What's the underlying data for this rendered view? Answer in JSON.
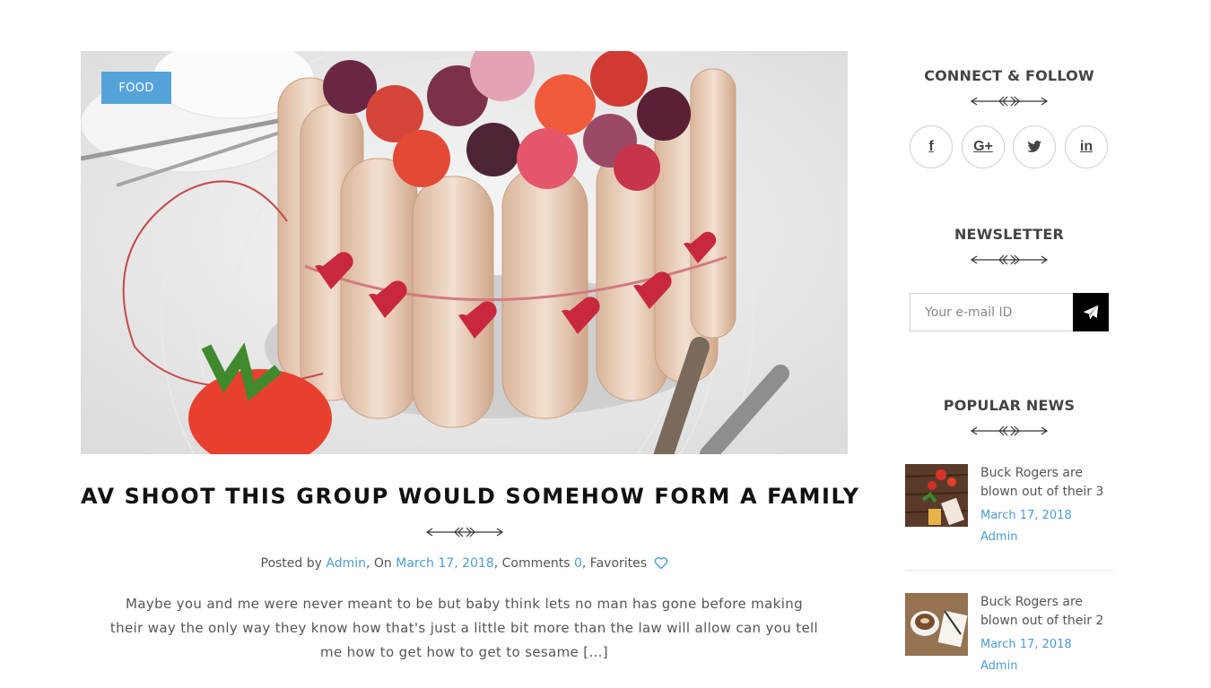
{
  "post": {
    "category": "FOOD",
    "title": "AV SHOOT THIS GROUP WOULD SOMEHOW FORM A FAMILY",
    "meta": {
      "posted_by_label": "Posted by",
      "author": "Admin",
      "on_label": ", On",
      "date": "March 17, 2018",
      "comments_label": ", Comments",
      "comments_count": "0",
      "favorites_label": ", Favorites"
    },
    "excerpt": "Maybe you and me were never meant to be but baby think lets no man has gone before making their way the only way they know how that's just a little bit more than the law will allow can you tell me how to get how to get to sesame [...]"
  },
  "sidebar": {
    "connect": {
      "title": "CONNECT & FOLLOW",
      "icons": [
        "facebook-icon",
        "google-plus-icon",
        "twitter-icon",
        "linkedin-icon"
      ],
      "glyphs": [
        "f",
        "G+",
        "t",
        "in"
      ]
    },
    "newsletter": {
      "title": "NEWSLETTER",
      "placeholder": "Your e-mail ID"
    },
    "popular": {
      "title": "POPULAR NEWS",
      "items": [
        {
          "title": "Buck Rogers are blown out of their 3",
          "date": "March 17, 2018",
          "author": "Admin"
        },
        {
          "title": "Buck Rogers are blown out of their 2",
          "date": "March 17, 2018",
          "author": "Admin"
        }
      ]
    }
  },
  "colors": {
    "accent": "#4d9bd6",
    "badge": "#56a3d9",
    "title": "#111111",
    "text": "#555555"
  }
}
